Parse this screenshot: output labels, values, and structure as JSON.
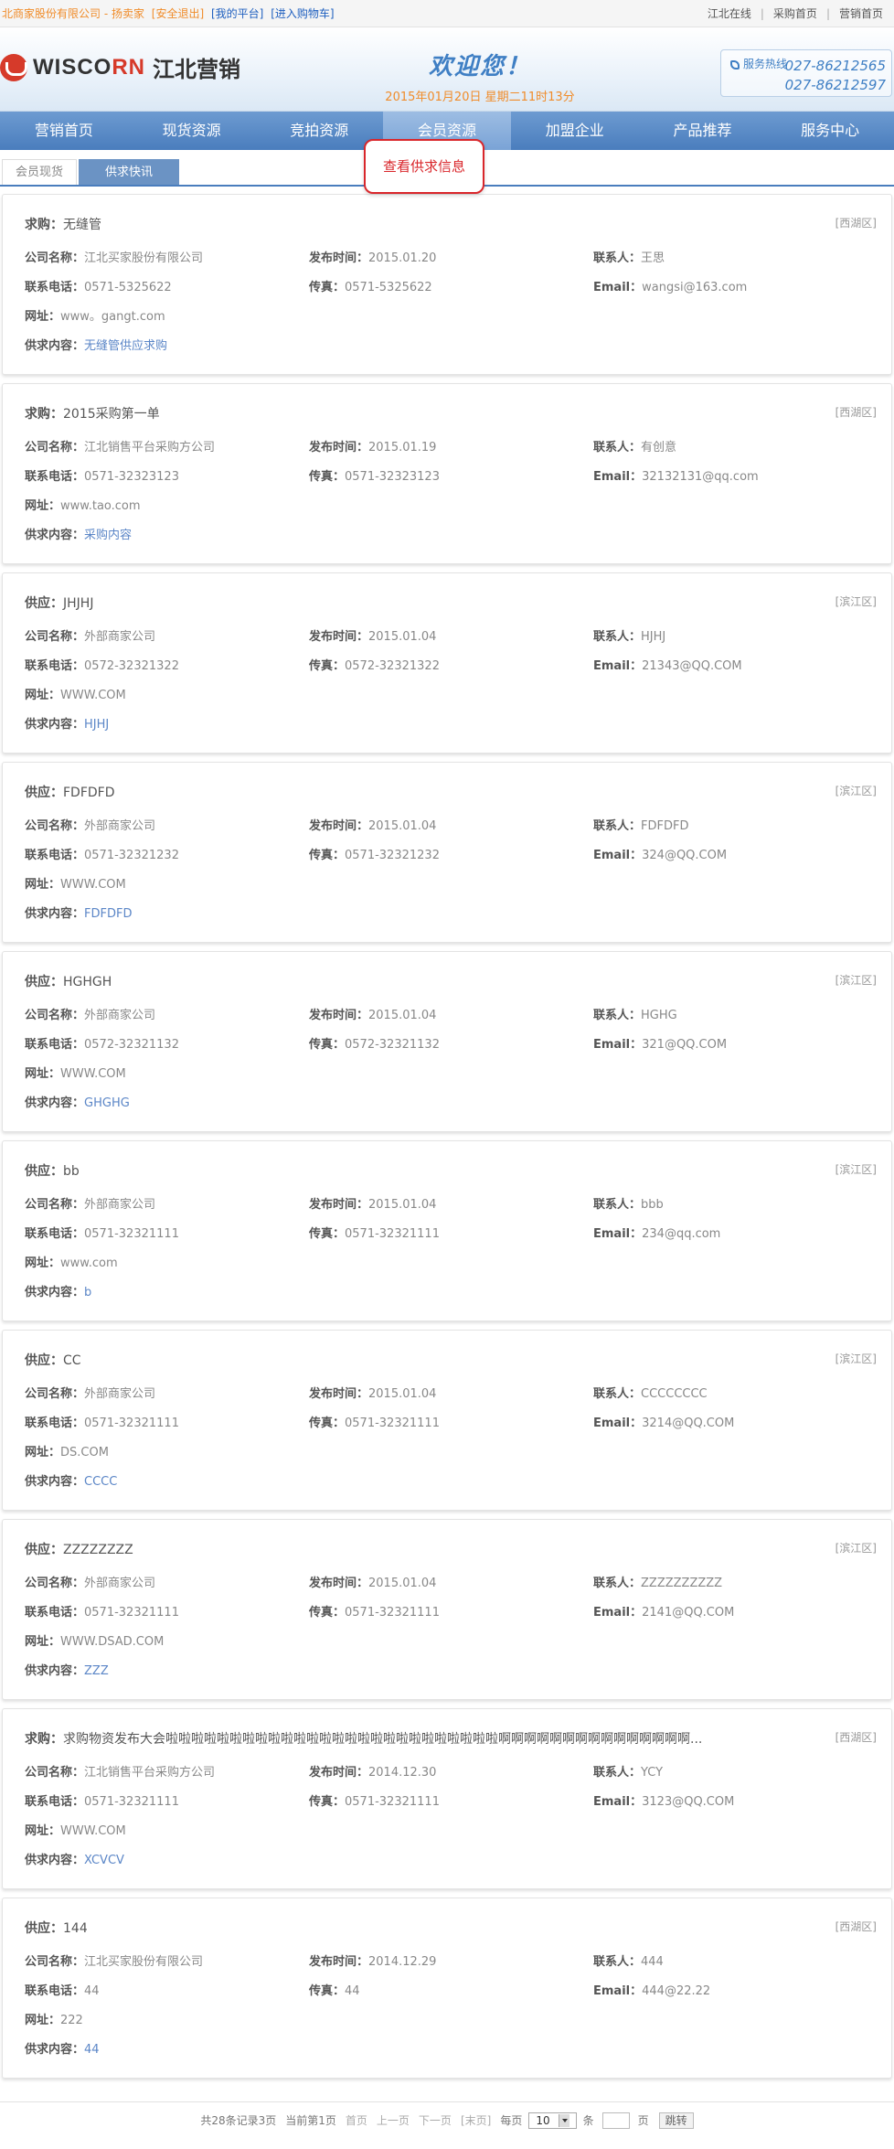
{
  "topbar": {
    "company": "北商家股份有限公司 - 扬卖家",
    "logout": "[安全退出]",
    "platform": "[我的平台]",
    "cart": "[进入购物车]",
    "right_links": [
      "江北在线",
      "采购首页",
      "营销首页"
    ]
  },
  "header": {
    "brand_left": "WISCO",
    "brand_red": "RN",
    "brand_cn": "江北营销",
    "welcome": "欢迎您！",
    "date": "2015年01月20日 星期二11时13分",
    "hotline_label": "服务热线",
    "hotline_1": "027-86212565",
    "hotline_2": "027-86212597"
  },
  "nav": [
    "营销首页",
    "现货资源",
    "竞拍资源",
    "会员资源",
    "加盟企业",
    "产品推荐",
    "服务中心"
  ],
  "nav_active_index": 3,
  "subtabs": [
    "会员现货",
    "供求快讯"
  ],
  "labels": {
    "company": "公司名称：",
    "publish": "发布时间：",
    "contact": "联系人：",
    "phone": "联系电话：",
    "fax": "传真：",
    "email": "Email：",
    "site": "网址：",
    "content": "供求内容："
  },
  "tooltip": "查看供求信息",
  "cards": [
    {
      "kind": "求购：",
      "title": "无缝管",
      "region": "[西湖区]",
      "company": "江北买家股份有限公司",
      "publish": "2015.01.20",
      "contact": "王思",
      "phone": "0571-5325622",
      "fax": "0571-5325622",
      "email": "wangsi@163.com",
      "site": "www。gangt.com",
      "content": "无缝管供应求购"
    },
    {
      "kind": "求购：",
      "title": "2015采购第一单",
      "region": "[西湖区]",
      "company": "江北销售平台采购方公司",
      "publish": "2015.01.19",
      "contact": "有创意",
      "phone": "0571-32323123",
      "fax": "0571-32323123",
      "email": "32132131@qq.com",
      "site": "www.tao.com",
      "content": "采购内容"
    },
    {
      "kind": "供应：",
      "title": "JHJHJ",
      "region": "[滨江区]",
      "company": "外部商家公司",
      "publish": "2015.01.04",
      "contact": "HJHJ",
      "phone": "0572-32321322",
      "fax": "0572-32321322",
      "email": "21343@QQ.COM",
      "site": "WWW.COM",
      "content": "HJHJ"
    },
    {
      "kind": "供应：",
      "title": "FDFDFD",
      "region": "[滨江区]",
      "company": "外部商家公司",
      "publish": "2015.01.04",
      "contact": "FDFDFD",
      "phone": "0571-32321232",
      "fax": "0571-32321232",
      "email": "324@QQ.COM",
      "site": "WWW.COM",
      "content": "FDFDFD"
    },
    {
      "kind": "供应：",
      "title": "HGHGH",
      "region": "[滨江区]",
      "company": "外部商家公司",
      "publish": "2015.01.04",
      "contact": "HGHG",
      "phone": "0572-32321132",
      "fax": "0572-32321132",
      "email": "321@QQ.COM",
      "site": "WWW.COM",
      "content": "GHGHG"
    },
    {
      "kind": "供应：",
      "title": "bb",
      "region": "[滨江区]",
      "company": "外部商家公司",
      "publish": "2015.01.04",
      "contact": "bbb",
      "phone": "0571-32321111",
      "fax": "0571-32321111",
      "email": "234@qq.com",
      "site": "www.com",
      "content": "b"
    },
    {
      "kind": "供应：",
      "title": "CC",
      "region": "[滨江区]",
      "company": "外部商家公司",
      "publish": "2015.01.04",
      "contact": "CCCCCCCC",
      "phone": "0571-32321111",
      "fax": "0571-32321111",
      "email": "3214@QQ.COM",
      "site": "DS.COM",
      "content": "CCCC"
    },
    {
      "kind": "供应：",
      "title": "ZZZZZZZZ",
      "region": "[滨江区]",
      "company": "外部商家公司",
      "publish": "2015.01.04",
      "contact": "ZZZZZZZZZZ",
      "phone": "0571-32321111",
      "fax": "0571-32321111",
      "email": "2141@QQ.COM",
      "site": "WWW.DSAD.COM",
      "content": "ZZZ"
    },
    {
      "kind": "求购：",
      "title": "求购物资发布大会啦啦啦啦啦啦啦啦啦啦啦啦啦啦啦啦啦啦啦啦啦啦啦啦啦啦啊啊啊啊啊啊啊啊啊啊啊啊啊啊啊...",
      "region": "[西湖区]",
      "company": "江北销售平台采购方公司",
      "publish": "2014.12.30",
      "contact": "YCY",
      "phone": "0571-32321111",
      "fax": "0571-32321111",
      "email": "3123@QQ.COM",
      "site": "WWW.COM",
      "content": "XCVCV"
    },
    {
      "kind": "供应：",
      "title": "144",
      "region": "[西湖区]",
      "company": "江北买家股份有限公司",
      "publish": "2014.12.29",
      "contact": "444",
      "phone": "44",
      "fax": "44",
      "email": "444@22.22",
      "site": "222",
      "content": "44"
    }
  ],
  "pager": {
    "total": "共28条记录3页",
    "current": "当前第1页",
    "first": "首页",
    "prev": "上一页",
    "next": "下一页",
    "last": "[末页]",
    "per_page_label": "每页",
    "per_page_value": "10",
    "per_page_unit": "条",
    "page_unit": "页",
    "go": "跳转"
  }
}
